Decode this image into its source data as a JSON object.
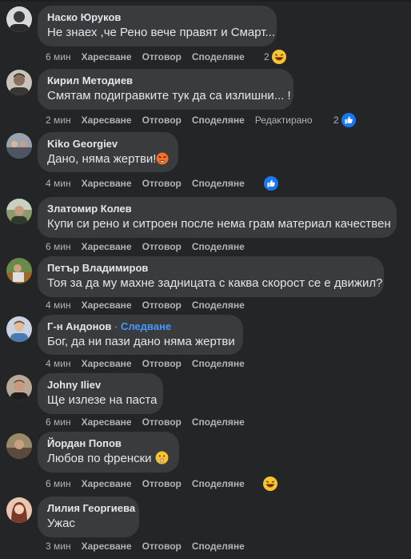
{
  "actions": {
    "like": "Харесване",
    "reply": "Отговор",
    "share": "Споделяне"
  },
  "comments": [
    {
      "author": "Наско Юруков",
      "text": "Не знаех ,че Рено вече правят и Смарт...",
      "time": "6 мин",
      "reaction_count": "2",
      "reaction_icon": "laughing-emoji-icon",
      "avatar_color": "#6b6f75"
    },
    {
      "author": "Кирил Методиев",
      "text": "Смятам подигравките тук да са излишни... !",
      "time": "2 мин",
      "edited": "Редактирано",
      "reaction_count": "2",
      "reaction_icon": "like-icon",
      "avatar_color": "#8a7a6a"
    },
    {
      "author": "Kiko Georgiev",
      "text": "Дано, няма жертви!",
      "text_emoji": "angry-emoji-icon",
      "time": "4 мин",
      "reaction_count": "",
      "reaction_icon": "like-icon",
      "avatar_color": "#7a8290"
    },
    {
      "author": "Златомир Колев",
      "text": "Купи си рено и ситроен после нема грам материал качествен",
      "time": "6 мин",
      "avatar_color": "#5e6a4f"
    },
    {
      "author": "Петър Владимиров",
      "text": "Тоя за да му махне задницата с каква скорост се е движил?",
      "time": "4 мин",
      "avatar_color": "#8a5c3c"
    },
    {
      "author": "Г-н Андонов",
      "follow": "Следване",
      "text": "Бог, да ни пази дано няма жертви",
      "time": "4 мин",
      "avatar_color": "#a0b0c8"
    },
    {
      "author": "Johny Iliev",
      "text": "Ще излезе на паста",
      "time": "6 мин",
      "avatar_color": "#6a5a50"
    },
    {
      "author": "Йордан Попов",
      "text": "Любов по френски",
      "text_emoji": "shushing-emoji-icon",
      "time": "6 мин",
      "reaction_count": "",
      "reaction_icon": "laughing-emoji-icon",
      "avatar_color": "#7a6a58"
    },
    {
      "author": "Лилия Георгиева",
      "text": "Ужас",
      "time": "3 мин",
      "avatar_color": "#b0887a"
    }
  ]
}
